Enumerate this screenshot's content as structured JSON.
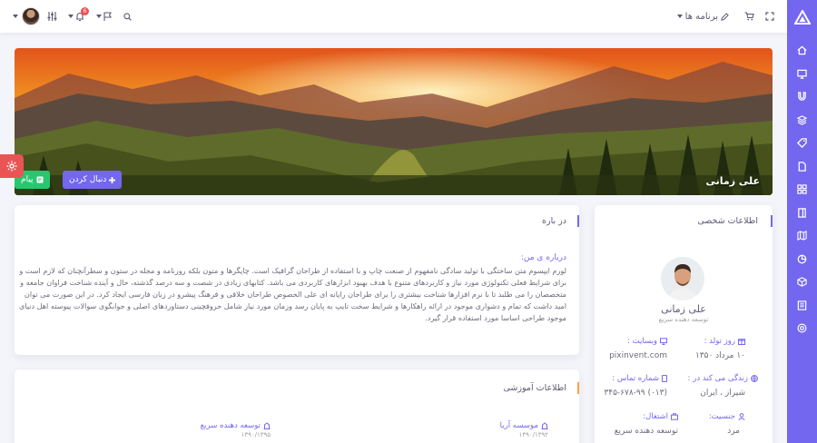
{
  "topbar": {
    "apps_label": "برنامه ها",
    "notification_count": "6"
  },
  "cover": {
    "user_name": "علی زمانی",
    "follow_label": "دنبال کردن",
    "message_label": "پیام"
  },
  "about": {
    "title": "در باره",
    "subtitle": "درباره ی من:",
    "text": "لورم ایپسوم متن ساختگی با تولید سادگی نامفهوم از صنعت چاپ و با استفاده از طراحان گرافیک است. چاپگرها و متون بلکه روزنامه و مجله در ستون و سطرآنچنان که لازم است و برای شرایط فعلی تکنولوژی مورد نیاز و کاربردهای متنوع با هدف بهبود ابزارهای کاربردی می باشد. کتابهای زیادی در شصت و سه درصد گذشته، حال و آینده شناخت فراوان جامعه و متخصصان را می طلبد تا با نرم افزارها شناخت بیشتری را برای طراحان رایانه ای علی الخصوص طراحان خلاقی و فرهنگ پیشرو در زبان فارسی ایجاد کرد. در این صورت می توان امید داشت که تمام و دشواری موجود در ارائه راهکارها و شرایط سخت تایپ به پایان رسد وزمان مورد نیاز شامل حروفچینی دستاوردهای اصلی و جوابگوی سوالات پیوسته اهل دنیای موجود طراحی اساسا مورد استفاده قرار گیرد."
  },
  "education": {
    "title": "اطلاعات آموزشی",
    "items": [
      {
        "name": "موسسه آریا",
        "years": "۱۳۹۰/۱۳۹۲"
      },
      {
        "name": "توسعه دهنده سریع",
        "years": "۱۳۹۰/۱۳۹۵"
      }
    ]
  },
  "personal": {
    "title": "اطلاعات شخصی",
    "name": "علی زمانی",
    "role": "توسعه دهنده سریع",
    "fields": {
      "birthday_label": "روز تولد :",
      "birthday_value": "۱۰ مرداد ۱۳۵۰",
      "website_label": "وبسایت :",
      "website_value": "pixinvent.com",
      "lives_label": "زندگی می کند در :",
      "lives_value": "شیراز ، ایران",
      "phone_label": "شماره تماس :",
      "phone_value": "(۰۱۳) ۳۴۵-۶۷۸-۹۹",
      "gender_label": "جنسیت:",
      "gender_value": "مرد",
      "job_label": "اشتغال:",
      "job_value": "توسعه دهنده سریع"
    }
  },
  "colors": {
    "primary": "#7367f0",
    "success": "#28c76f",
    "danger": "#ea5455",
    "warning": "#ff9f43"
  },
  "icons": {
    "sidebar": [
      "home-icon",
      "monitor-icon",
      "magnet-icon",
      "layers-icon",
      "tag-icon",
      "file-icon",
      "grid-icon",
      "sidebar-icon",
      "map-icon",
      "pie-chart-icon",
      "package-icon",
      "book-icon",
      "life-buoy-icon"
    ],
    "topbar": [
      "fullscreen-icon",
      "cart-icon",
      "edit-icon",
      "search-icon",
      "flag-icon",
      "bell-icon",
      "sliders-icon"
    ]
  }
}
